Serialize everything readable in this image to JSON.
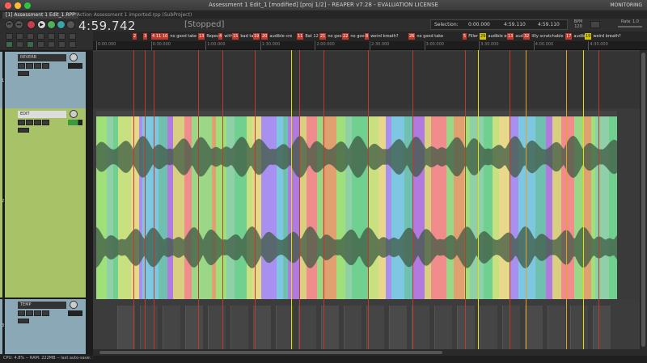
{
  "window": {
    "title": "Assessment 1 Edit_1 [modified] [proj 1/2] - REAPER v7.28 - EVALUATION LICENSE",
    "monitoring": "MONITORING"
  },
  "project_tabs": [
    {
      "label": "[1] Assessment 1 Edit_1.RPP"
    },
    {
      "label": "*Action Assessment 1 imported.rpp (SubProject)"
    }
  ],
  "transport": {
    "time": "4:59.742",
    "status": "[Stopped]",
    "selection_label": "Selection:",
    "selection_start": "0:00.000",
    "selection_end": "4:59.110",
    "selection_length": "4:59.110",
    "bpm_label": "BPM",
    "bpm": "120",
    "rate_label": "Rate",
    "rate": "1.0"
  },
  "regions": [
    {
      "num": "2",
      "label": ""
    },
    {
      "num": "3",
      "label": ""
    },
    {
      "num": "4 11",
      "label": ""
    },
    {
      "num": "10",
      "label": "no good take"
    },
    {
      "num": "13",
      "label": "Repeat"
    },
    {
      "num": "4",
      "label": "with"
    },
    {
      "num": "15",
      "label": "bad take"
    },
    {
      "num": "19",
      "label": ""
    },
    {
      "num": "20",
      "label": "audible cre"
    },
    {
      "num": "11",
      "label": "Bat 12"
    },
    {
      "num": "21",
      "label": "no good"
    },
    {
      "num": "22",
      "label": "no good"
    },
    {
      "num": "8",
      "label": "weird breath?"
    },
    {
      "num": "26",
      "label": "no good take"
    },
    {
      "num": "5",
      "label": "Filler"
    },
    {
      "num": "29",
      "label": "audible edit"
    },
    {
      "num": "13",
      "label": "audd"
    },
    {
      "num": "32",
      "label": "lilly scratchable"
    },
    {
      "num": "17",
      "label": "audible"
    },
    {
      "num": "19",
      "label": "weird breath?"
    }
  ],
  "ruler_ticks": [
    "0:00.000",
    "0:30.000",
    "1:00.000",
    "1:30.000",
    "2:00.000",
    "2:30.000",
    "3:00.000",
    "3:30.000",
    "4:00.000",
    "4:30.000"
  ],
  "tracks": [
    {
      "num": "1",
      "name": "REVERB",
      "color": "#8aa8b5"
    },
    {
      "num": "2",
      "name": "EDIT",
      "color": "#a7c267"
    },
    {
      "num": "3",
      "name": "TEMP",
      "color": "#8aa8b5"
    }
  ],
  "status_bar": "CPU: 4.8% -- RAM: 222MB -- last auto-save: 10:33 --",
  "colors": {
    "red_marker": "#c0392b",
    "yellow_marker": "#e8e000",
    "orange_marker": "#e8a020"
  }
}
